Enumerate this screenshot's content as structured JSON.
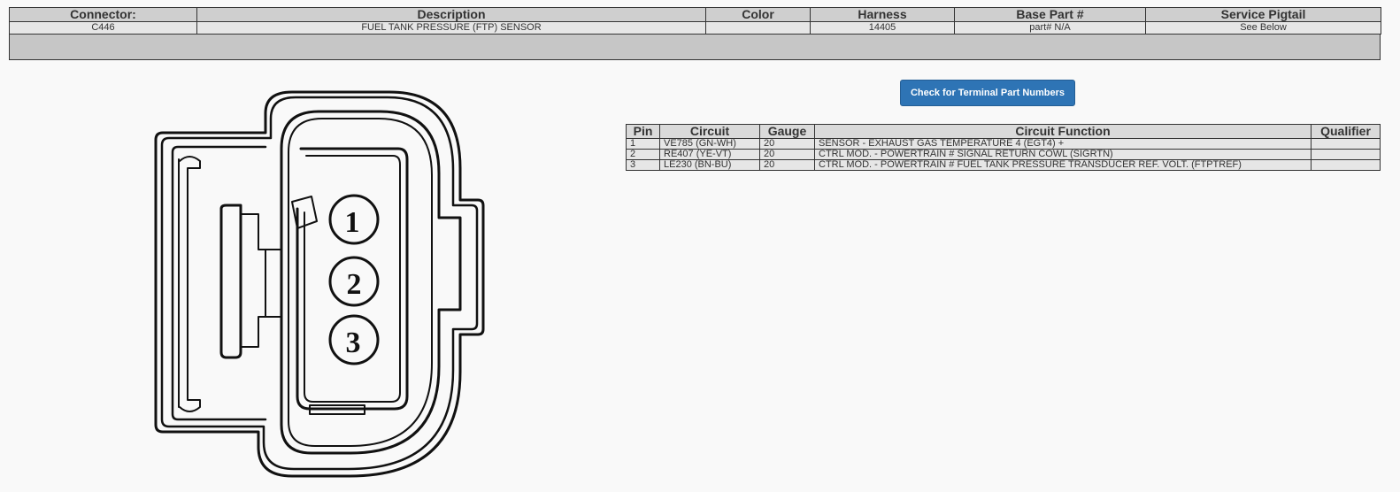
{
  "header": {
    "columns": [
      "Connector:",
      "Description",
      "Color",
      "Harness",
      "Base Part #",
      "Service Pigtail"
    ],
    "row": {
      "connector": "C446",
      "description": "FUEL TANK PRESSURE (FTP) SENSOR",
      "color": "",
      "harness": "14405",
      "base_part": "part# N/A",
      "service_pigtail": "See Below"
    }
  },
  "button": {
    "label": "Check for Terminal Part Numbers",
    "color": "#2e74b5"
  },
  "pin_table": {
    "columns": [
      "Pin",
      "Circuit",
      "Gauge",
      "Circuit Function",
      "Qualifier"
    ],
    "rows": [
      {
        "pin": "1",
        "circuit": "VE785 (GN-WH)",
        "gauge": "20",
        "function": "SENSOR - EXHAUST GAS TEMPERATURE 4 (EGT4) +",
        "qualifier": ""
      },
      {
        "pin": "2",
        "circuit": "RE407 (YE-VT)",
        "gauge": "20",
        "function": "CTRL MOD. - POWERTRAIN # SIGNAL RETURN COWL (SIGRTN)",
        "qualifier": ""
      },
      {
        "pin": "3",
        "circuit": "LE230 (BN-BU)",
        "gauge": "20",
        "function": "CTRL MOD. - POWERTRAIN # FUEL TANK PRESSURE TRANSDUCER REF. VOLT. (FTPTREF)",
        "qualifier": ""
      }
    ]
  },
  "connector_diagram": {
    "pins": [
      "1",
      "2",
      "3"
    ]
  }
}
